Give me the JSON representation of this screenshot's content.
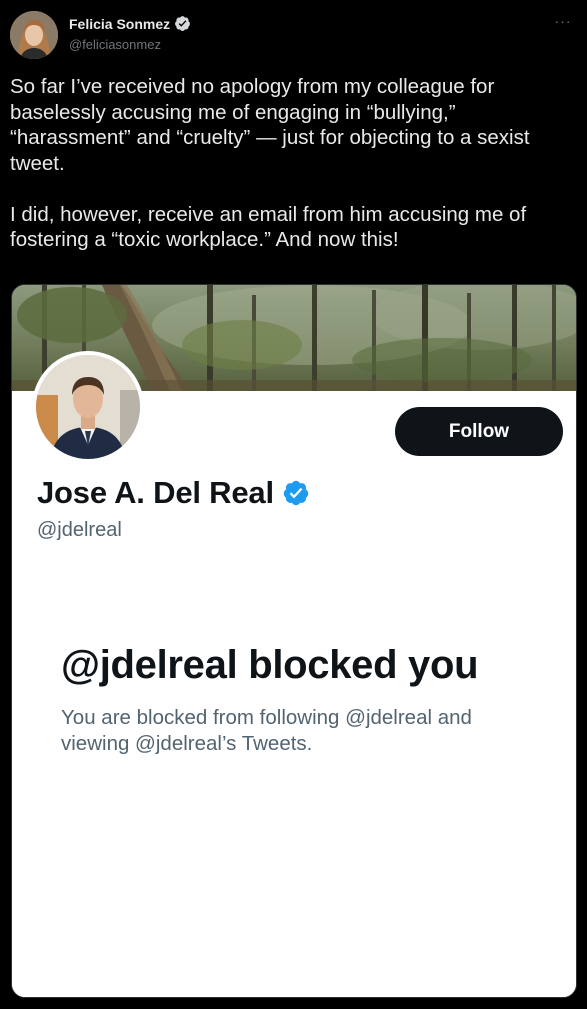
{
  "tweet": {
    "author": {
      "name": "Felicia Sonmez",
      "handle": "@feliciasonmez",
      "verified_icon": "verified-badge-icon",
      "avatar_icon": "user-avatar"
    },
    "more_label": "···",
    "text": "So far I’ve received no apology from my colleague for baselessly accusing me of engaging in “bullying,” “harassment” and “cruelty” — just for objecting to a sexist tweet.\n\nI did, however, receive an email from him accusing me of fostering a “toxic workplace.” And now this!"
  },
  "screenshot_card": {
    "banner_icon": "forest-banner-image",
    "profile": {
      "name": "Jose A. Del Real",
      "handle": "@jdelreal",
      "follow_label": "Follow",
      "verified_icon": "verified-badge-icon"
    },
    "blocked": {
      "title": "@jdelreal blocked you",
      "description": "You are blocked from following @jdelreal and viewing @jdelreal’s Tweets."
    }
  },
  "colors": {
    "background": "#000000",
    "text_primary": "#e7e9ea",
    "text_secondary": "#71767b",
    "verified_blue": "#1d9bf0",
    "card_text": "#0f1419",
    "card_secondary": "#536471"
  }
}
